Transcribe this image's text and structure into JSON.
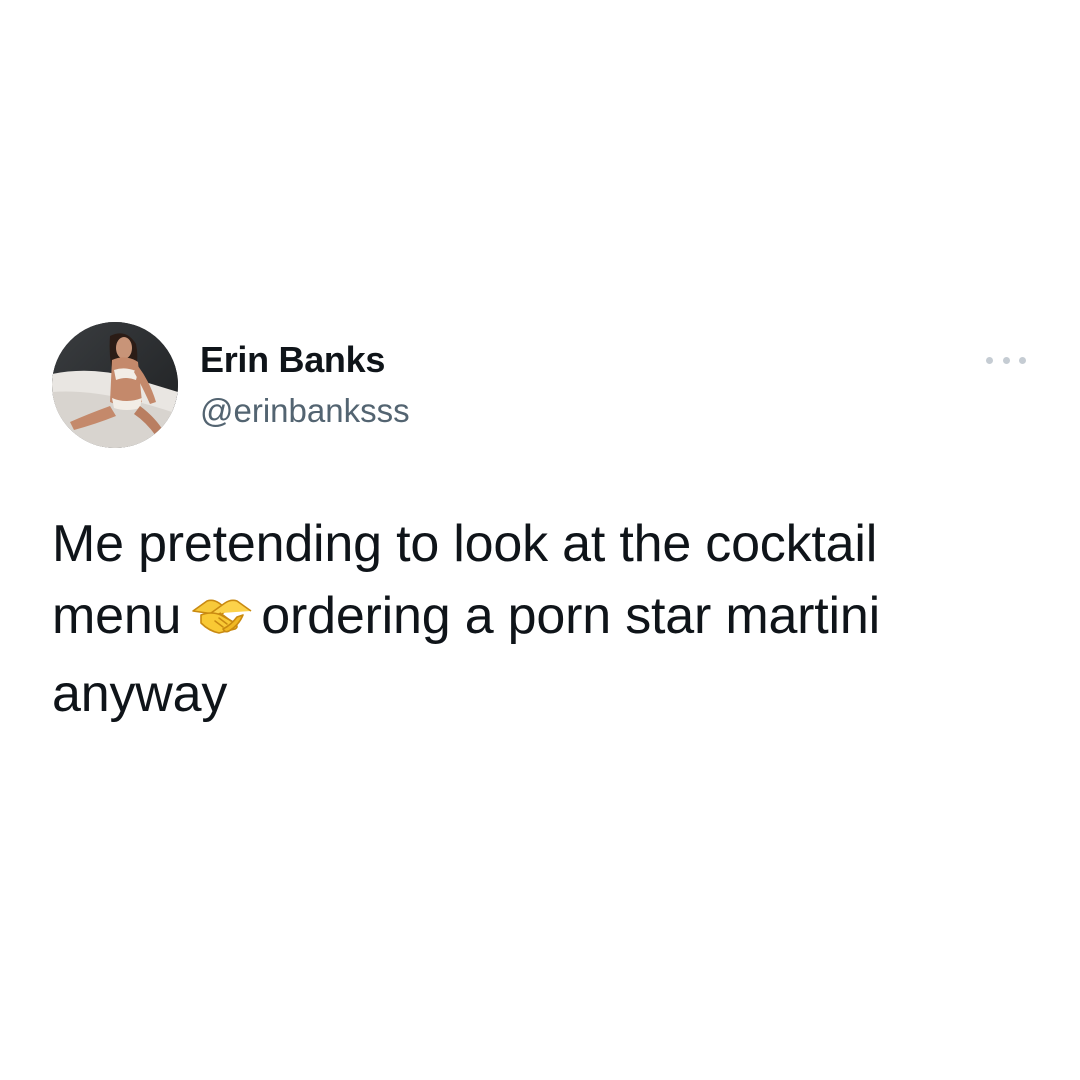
{
  "tweet": {
    "author": {
      "display_name": "Erin Banks",
      "handle": "@erinbanksss"
    },
    "more_icon": "more-horizontal-icon",
    "text": {
      "part1": "Me pretending to look at the cocktail menu",
      "emoji": "handshake-emoji",
      "part2": "ordering a porn star martini anyway"
    }
  },
  "colors": {
    "text_primary": "#0f1419",
    "text_secondary": "#536471",
    "icon_muted": "#c5ccd3",
    "background": "#ffffff"
  }
}
